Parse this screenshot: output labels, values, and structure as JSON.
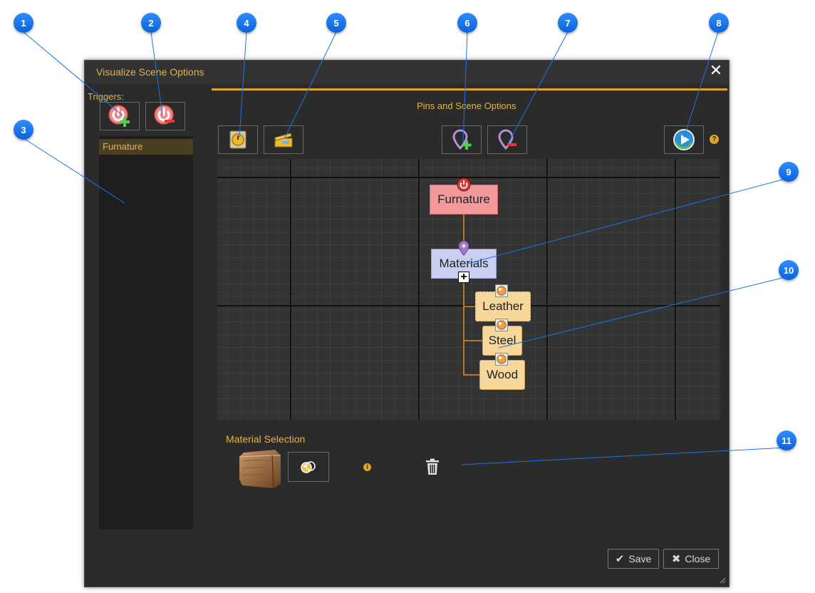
{
  "window": {
    "title": "Visualize Scene Options"
  },
  "triggers": {
    "label": "Triggers:",
    "items": [
      "Furnature"
    ]
  },
  "pins_section": {
    "title": "Pins and Scene Options",
    "help_glyph": "?"
  },
  "graph": {
    "root": "Furnature",
    "child": "Materials",
    "leaves": [
      "Leather",
      "Steel",
      "Wood"
    ],
    "expand_glyph": "+"
  },
  "material_selection": {
    "label": "Material Selection",
    "info_glyph": "i"
  },
  "footer": {
    "save": "Save",
    "close": "Close"
  },
  "callouts": [
    "1",
    "2",
    "3",
    "4",
    "5",
    "6",
    "7",
    "8",
    "9",
    "10",
    "11"
  ],
  "icons": {
    "add_trigger": "power-plus-icon",
    "remove_trigger": "power-minus-icon",
    "scene_option": "timer-icon",
    "clapper": "clapperboard-icon",
    "add_pin": "pin-plus-icon",
    "remove_pin": "pin-minus-icon",
    "play": "play-icon",
    "material": "material-swatch-icon",
    "trash": "trash-icon"
  },
  "colors": {
    "accent": "#e0b44a",
    "callout": "#1a73e8",
    "trigger_node": "#f2999b",
    "pin_node": "#c9cff0",
    "leaf_node": "#f7d89a"
  }
}
